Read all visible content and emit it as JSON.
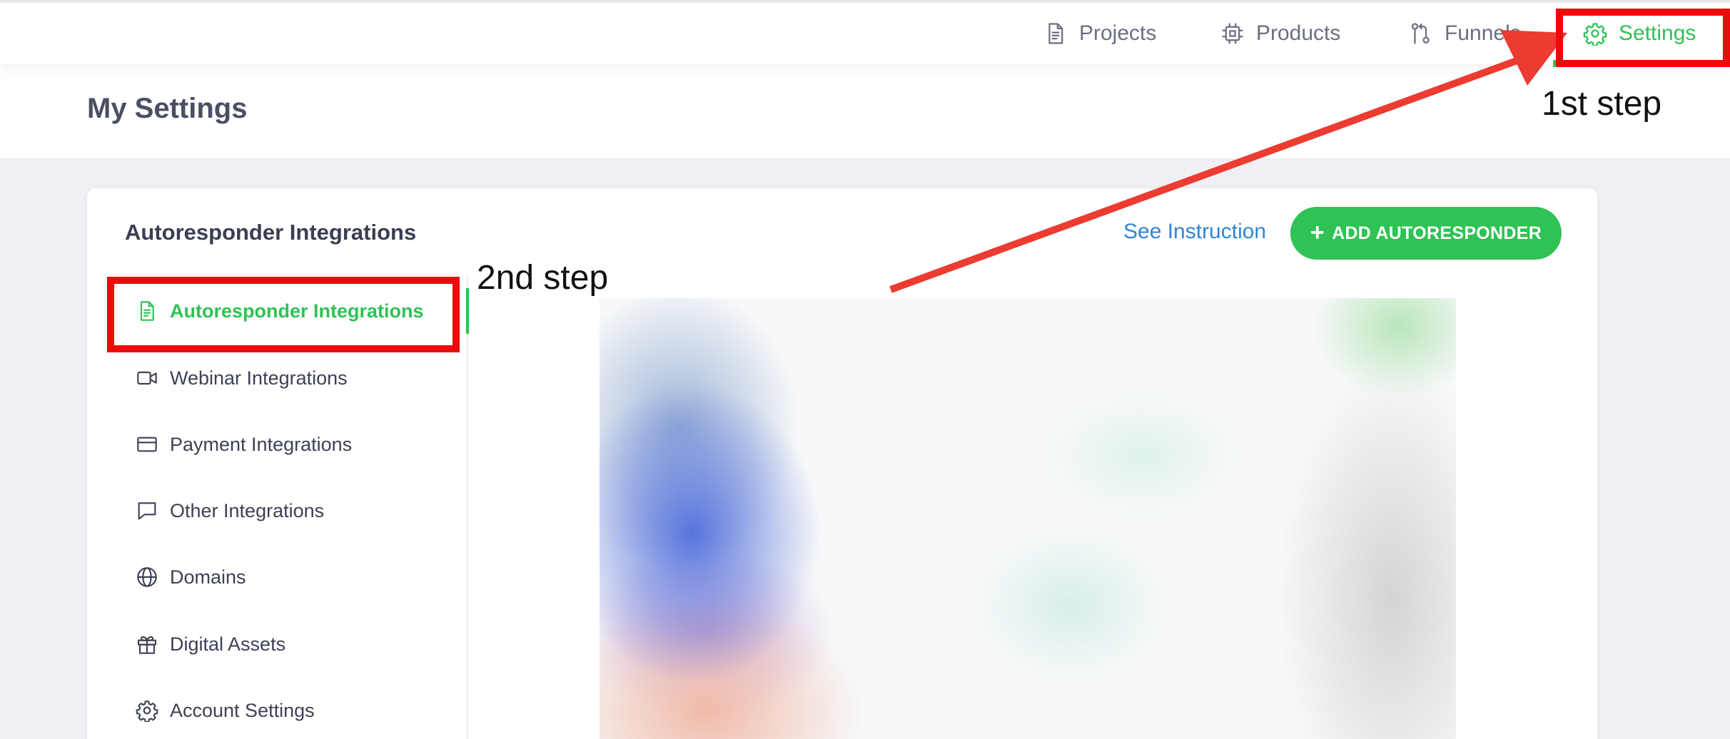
{
  "topnav": {
    "items": [
      {
        "label": "Projects",
        "icon": "document-icon",
        "active": false
      },
      {
        "label": "Products",
        "icon": "chip-icon",
        "active": false
      },
      {
        "label": "Funnels",
        "icon": "flow-icon",
        "active": false
      },
      {
        "label": "Settings",
        "icon": "gear-icon",
        "active": true
      }
    ]
  },
  "page": {
    "title": "My Settings"
  },
  "card": {
    "title": "Autoresponder Integrations",
    "see_instruction": "See Instruction",
    "add_button_plus": "+",
    "add_button_label": "ADD AUTORESPONDER"
  },
  "sidebar": {
    "items": [
      {
        "label": "Autoresponder Integrations",
        "icon": "document-icon",
        "active": true
      },
      {
        "label": "Webinar Integrations",
        "icon": "video-camera-icon",
        "active": false
      },
      {
        "label": "Payment Integrations",
        "icon": "credit-card-icon",
        "active": false
      },
      {
        "label": "Other Integrations",
        "icon": "chat-bubble-icon",
        "active": false
      },
      {
        "label": "Domains",
        "icon": "globe-icon",
        "active": false
      },
      {
        "label": "Digital Assets",
        "icon": "gift-icon",
        "active": false
      },
      {
        "label": "Account Settings",
        "icon": "gear-icon",
        "active": false
      }
    ]
  },
  "annotations": {
    "step1": "1st step",
    "step2": "2nd step"
  },
  "colors": {
    "accent": "#2fc254",
    "link": "#2f86d6",
    "annotation_red": "#ec0b0b",
    "page_bg": "#eef0f3"
  }
}
